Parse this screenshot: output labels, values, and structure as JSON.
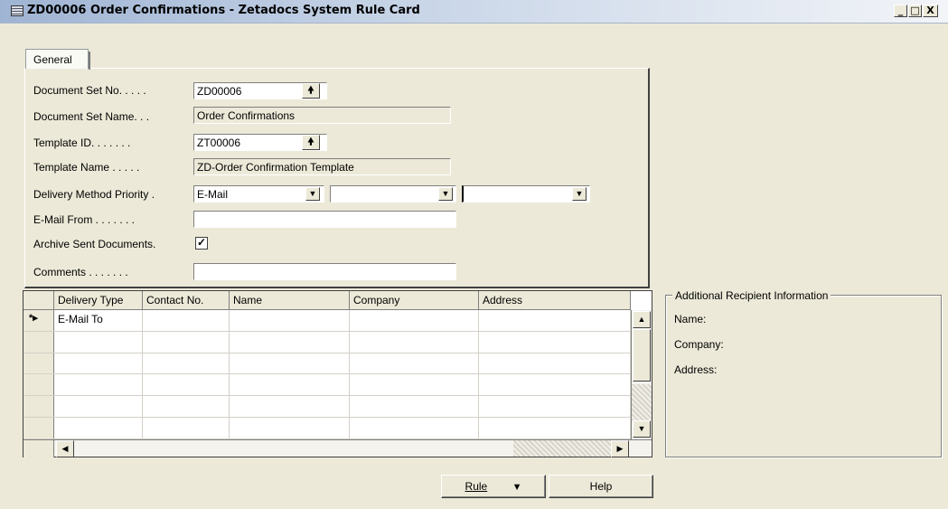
{
  "window": {
    "title": "ZD00006 Order Confirmations - Zetadocs System Rule Card",
    "minimize": "_",
    "maximize": "□",
    "close": "X"
  },
  "tabs": [
    {
      "label": "General"
    }
  ],
  "fields": {
    "document_set_no": {
      "label": "Document Set No. . . . .",
      "value": "ZD00006"
    },
    "document_set_name": {
      "label": "Document Set Name. . .",
      "value": "Order Confirmations"
    },
    "template_id": {
      "label": "Template ID. . . . . . .",
      "value": "ZT00006"
    },
    "template_name": {
      "label": "Template Name . . . . .",
      "value": "ZD-Order Confirmation Template"
    },
    "delivery_method_priority": {
      "label": "Delivery Method Priority .",
      "values": [
        "E-Mail",
        "",
        ""
      ]
    },
    "email_from": {
      "label": "E-Mail From . . . . . . .",
      "value": ""
    },
    "archive_sent_documents": {
      "label": "Archive Sent Documents.",
      "checked": "✓"
    },
    "comments": {
      "label": "Comments . . . . . . .",
      "value": ""
    }
  },
  "grid": {
    "columns": [
      "Delivery Type",
      "Contact No.",
      "Name",
      "Company",
      "Address"
    ],
    "new_row_marker": "*▸",
    "rows": [
      [
        "E-Mail To",
        "",
        "",
        "",
        ""
      ],
      [
        "",
        "",
        "",
        "",
        ""
      ],
      [
        "",
        "",
        "",
        "",
        ""
      ],
      [
        "",
        "",
        "",
        "",
        ""
      ],
      [
        "",
        "",
        "",
        "",
        ""
      ],
      [
        "",
        "",
        "",
        "",
        ""
      ]
    ]
  },
  "recipient_info": {
    "title": "Additional Recipient Information",
    "name_label": "Name:",
    "company_label": "Company:",
    "address_label": "Address:"
  },
  "buttons": {
    "rule_label": "Rule",
    "rule_arrow": "▼",
    "help_label": "Help"
  },
  "colors": {
    "window_bg": "#ece9d8",
    "title_gradient_start": "#9fb4d3",
    "field_bg": "#ffffff"
  }
}
